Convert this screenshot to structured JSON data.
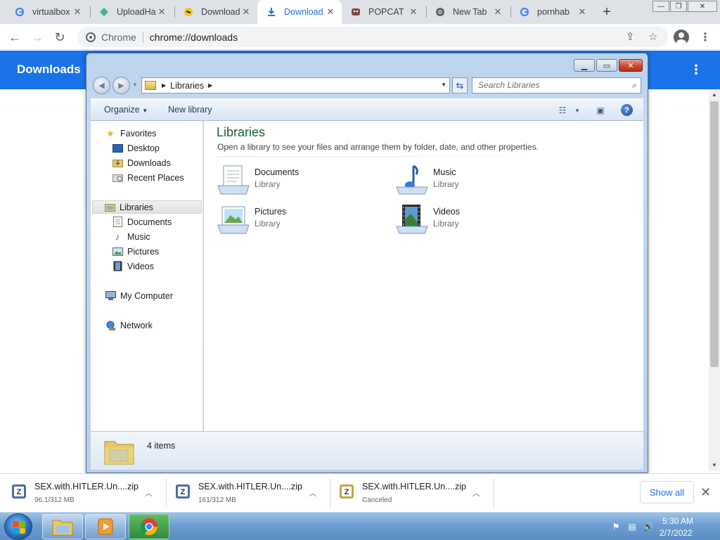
{
  "browser": {
    "tabs": [
      {
        "title": "virtualbox",
        "favicon": "google-icon",
        "active": false
      },
      {
        "title": "UploadHa",
        "favicon": "uploadhaven-icon",
        "active": false
      },
      {
        "title": "Download",
        "favicon": "download-site-icon",
        "active": false
      },
      {
        "title": "Download",
        "favicon": "download-arrow-icon",
        "active": true
      },
      {
        "title": "POPCAT",
        "favicon": "popcat-icon",
        "active": false
      },
      {
        "title": "New Tab",
        "favicon": "chrome-icon",
        "active": false
      },
      {
        "title": "pornhab",
        "favicon": "google-icon",
        "active": false
      }
    ],
    "omnibox": {
      "scheme_label": "Chrome",
      "url": "chrome://downloads"
    },
    "accent_color": "#1a73e8"
  },
  "downloads_page": {
    "title": "Downloads"
  },
  "explorer": {
    "address_crumb": "Libraries",
    "search_placeholder": "Search Libraries",
    "toolbar": {
      "organize": "Organize",
      "new_library": "New library"
    },
    "nav": {
      "favorites": "Favorites",
      "desktop": "Desktop",
      "downloads": "Downloads",
      "recent_places": "Recent Places",
      "libraries": "Libraries",
      "documents": "Documents",
      "music": "Music",
      "pictures": "Pictures",
      "videos": "Videos",
      "my_computer": "My Computer",
      "network": "Network"
    },
    "heading": "Libraries",
    "subheading": "Open a library to see your files and arrange them by folder, date, and other properties.",
    "libraries": [
      {
        "name": "Documents",
        "type": "Library",
        "icon": "documents-library-icon"
      },
      {
        "name": "Music",
        "type": "Library",
        "icon": "music-library-icon"
      },
      {
        "name": "Pictures",
        "type": "Library",
        "icon": "pictures-library-icon"
      },
      {
        "name": "Videos",
        "type": "Library",
        "icon": "videos-library-icon"
      }
    ],
    "details": {
      "count": "4 items"
    }
  },
  "download_shelf": {
    "items": [
      {
        "name": "SEX.with.HITLER.Un....zip",
        "status": "96.1/312 MB"
      },
      {
        "name": "SEX.with.HITLER.Un....zip",
        "status": "161/312 MB"
      },
      {
        "name": "SEX.with.HITLER.Un....zip",
        "status": "Canceled"
      }
    ],
    "show_all": "Show all"
  },
  "taskbar": {
    "apps": [
      "explorer-icon",
      "media-player-icon",
      "chrome-icon"
    ],
    "clock": {
      "time": "5:30 AM",
      "date": "2/7/2022"
    }
  }
}
